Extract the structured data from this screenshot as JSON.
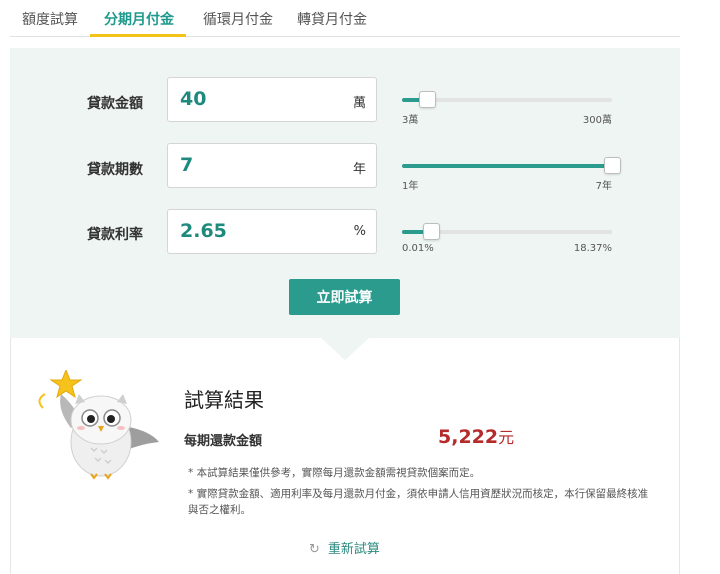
{
  "tabs": [
    {
      "label": "額度試算"
    },
    {
      "label": "分期月付金"
    },
    {
      "label": "循環月付金"
    },
    {
      "label": "轉貸月付金"
    }
  ],
  "active_tab": "分期月付金",
  "fields": {
    "amount": {
      "label": "貸款金額",
      "value": "40",
      "unit": "萬",
      "min_label": "3萬",
      "max_label": "300萬",
      "slider_fraction": 0.12
    },
    "period": {
      "label": "貸款期數",
      "value": "7",
      "unit": "年",
      "min_label": "1年",
      "max_label": "7年",
      "slider_fraction": 1.0
    },
    "rate": {
      "label": "貸款利率",
      "value": "2.65",
      "unit": "%",
      "min_label": "0.01%",
      "max_label": "18.37%",
      "slider_fraction": 0.14
    }
  },
  "calc_button": "立即試算",
  "result": {
    "title": "試算結果",
    "label": "每期還款金額",
    "value": "5,222",
    "unit": "元",
    "note1": "* 本試算結果僅供參考，實際每月還款金額需視貸款個案而定。",
    "note2": "* 實際貸款金額、適用利率及每月還款月付金，須依申請人信用資歷狀況而核定，本行保留最終核准與否之權利。",
    "reset_label": "重新試算",
    "reset_icon": "refresh-icon"
  },
  "colors": {
    "accent": "#2b9b8e",
    "tab_underline": "#f3c318",
    "panel_bg": "#eef5f3",
    "result_value": "#b52a2a"
  }
}
